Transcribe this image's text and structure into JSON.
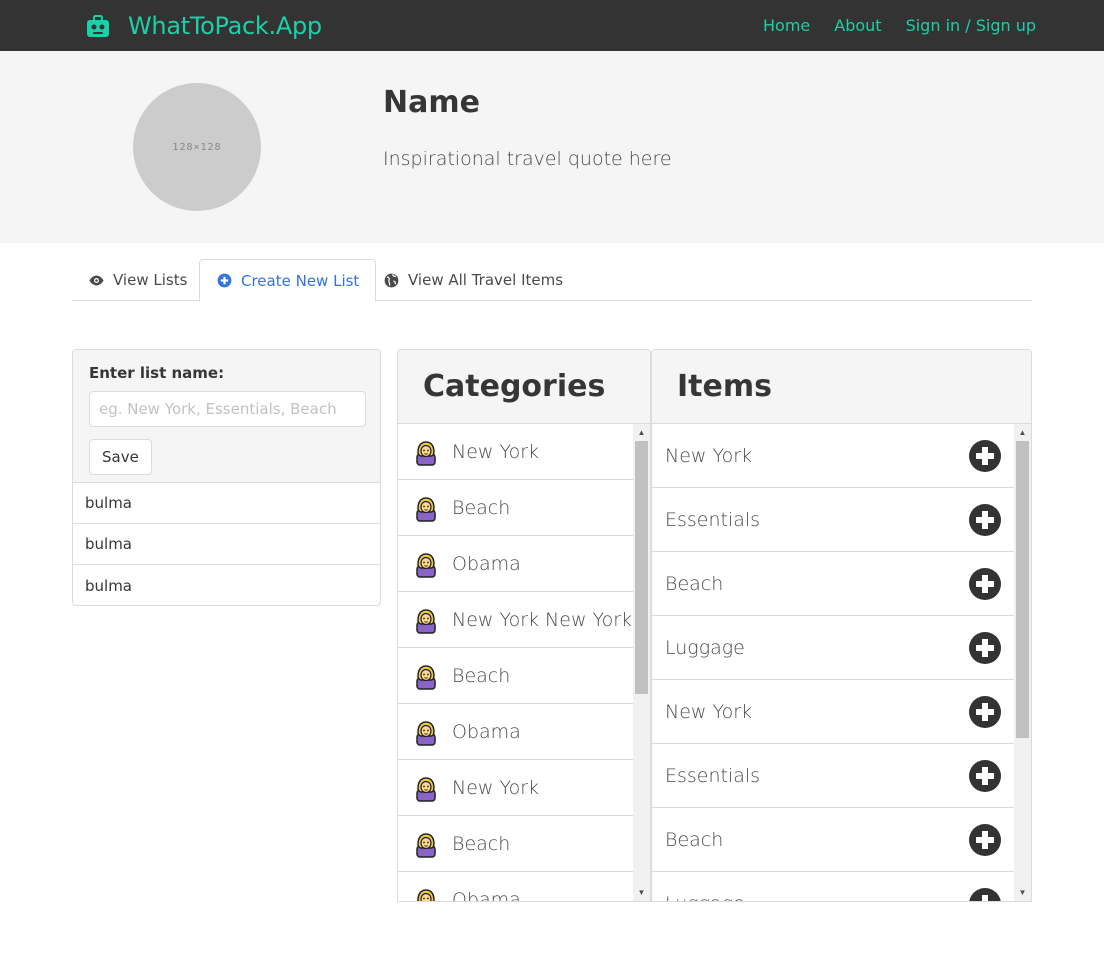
{
  "navbar": {
    "brand": "WhatToPack.App",
    "links": [
      "Home",
      "About",
      "Sign in / Sign up"
    ],
    "brand_color": "#1ccfa9",
    "background": "#333333"
  },
  "hero": {
    "avatar_placeholder": "128×128",
    "name": "Name",
    "quote": "Inspirational travel quote here"
  },
  "tabs": [
    {
      "label": "View Lists",
      "icon": "eye-icon"
    },
    {
      "label": "Create New List",
      "icon": "plus-circle-icon",
      "active": true
    },
    {
      "label": "View All Travel Items",
      "icon": "globe-icon"
    }
  ],
  "list_form": {
    "label": "Enter list name:",
    "placeholder": "eg. New York, Essentials, Beach",
    "value": "",
    "save_label": "Save"
  },
  "lists": [
    "bulma",
    "bulma",
    "bulma"
  ],
  "categories": {
    "title": "Categories",
    "items": [
      "New York",
      "Beach",
      "Obama",
      "New York New York",
      "Beach",
      "Obama",
      "New York",
      "Beach",
      "Obama"
    ]
  },
  "items": {
    "title": "Items",
    "items": [
      "New York",
      "Essentials",
      "Beach",
      "Luggage",
      "New York",
      "Essentials",
      "Beach",
      "Luggage"
    ]
  },
  "scroll": {
    "categories_thumb_fraction": 0.57,
    "items_thumb_fraction": 0.67
  }
}
